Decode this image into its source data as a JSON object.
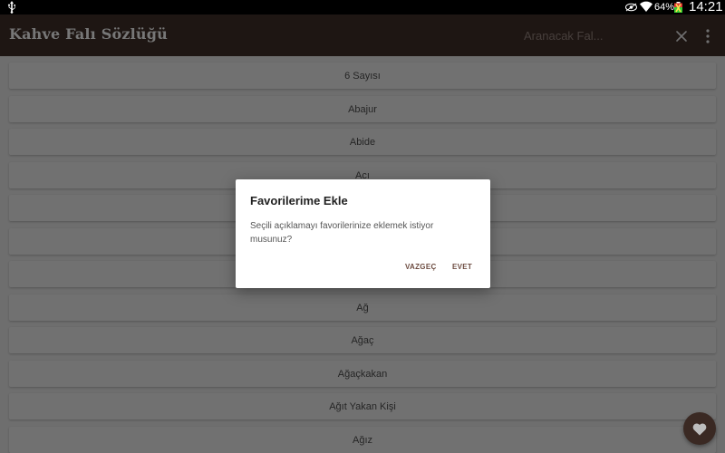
{
  "status_bar": {
    "battery_percent": "64%",
    "time": "14:21",
    "icons": [
      "usb-icon",
      "eye-icon",
      "wifi-icon",
      "battery-icon"
    ]
  },
  "app_bar": {
    "title": "Kahve Falı Sözlüğü",
    "search_placeholder": "Aranacak Fal...",
    "icons": [
      "close-icon",
      "more-vertical-icon"
    ],
    "background_color": "#3d2c27"
  },
  "list": {
    "items": [
      "6 Sayısı",
      "Abajur",
      "Abide",
      "Acı",
      "",
      "",
      "",
      "Ağ",
      "Ağaç",
      "Ağaçkakan",
      "Ağıt Yakan Kişi",
      "Ağız"
    ]
  },
  "dialog": {
    "title": "Favorilerime Ekle",
    "message": "Seçili açıklamayı favorilerinize eklemek istiyor musunuz?",
    "cancel_label": "VAZGEÇ",
    "confirm_label": "EVET",
    "accent_color": "#6d4c41"
  },
  "fab": {
    "icon": "heart-icon",
    "color": "#3a2923"
  }
}
